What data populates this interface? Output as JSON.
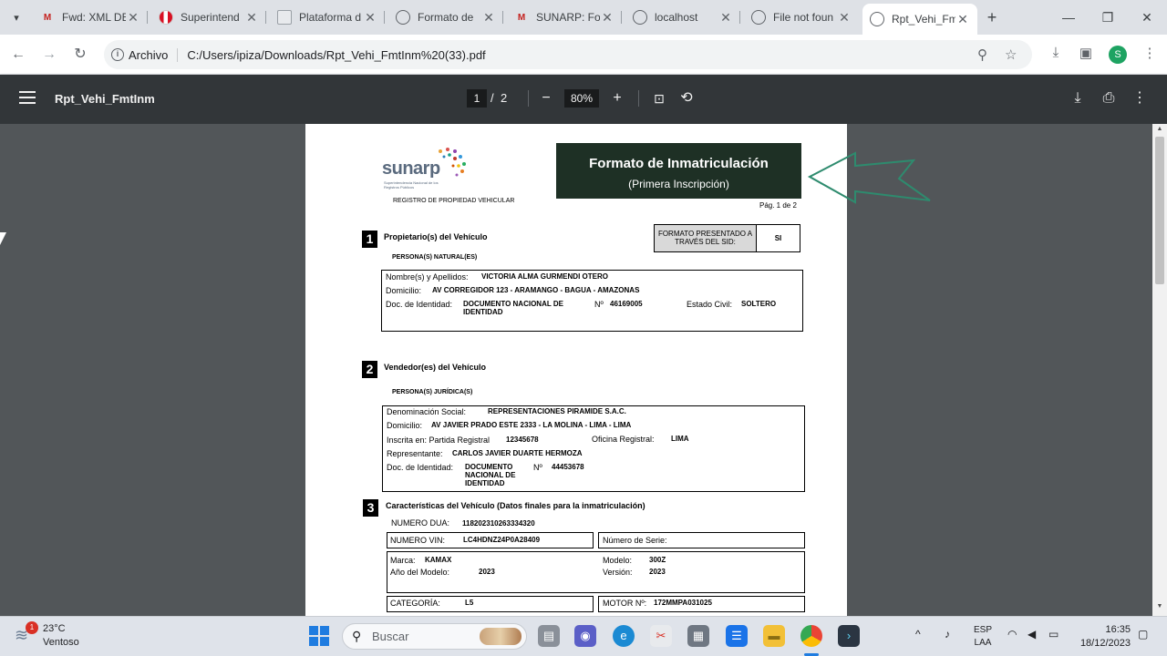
{
  "tabs": [
    {
      "title": "Fwd: XML DE",
      "favicon": "gmail-icon",
      "color": "#c5221f"
    },
    {
      "title": "Superintend",
      "favicon": "peru-flag-icon",
      "color": "#d91023"
    },
    {
      "title": "Plataforma d",
      "favicon": "document-icon",
      "color": "#8a8f95"
    },
    {
      "title": "Formato de",
      "favicon": "globe-icon",
      "color": "#5f6368"
    },
    {
      "title": "SUNARP: Fo",
      "favicon": "gmail-icon",
      "color": "#c5221f"
    },
    {
      "title": "localhost",
      "favicon": "globe-icon",
      "color": "#5f6368"
    },
    {
      "title": "File not foun",
      "favicon": "globe-icon",
      "color": "#5f6368"
    },
    {
      "title": "Rpt_Vehi_Fm",
      "favicon": "globe-icon",
      "color": "#5f6368",
      "active": true
    }
  ],
  "address": {
    "chip": "Archivo",
    "url": "C:/Users/ipiza/Downloads/Rpt_Vehi_FmtInm%20(33).pdf",
    "profile_initial": "S"
  },
  "pdf": {
    "title": "Rpt_Vehi_FmtInm",
    "current_page": "1",
    "separator": "/",
    "total_pages": "2",
    "zoom": "80%"
  },
  "document": {
    "logo": "sunarp",
    "logo_sub": "Superintendencia Nacional de los Registros Públicos",
    "registro": "REGISTRO DE PROPIEDAD VEHICULAR",
    "header_title": "Formato de Inmatriculación",
    "header_subtitle": "(Primera Inscripción)",
    "page_label": "Pág. 1 de 2",
    "sid_label": "FORMATO PRESENTADO A TRAVÉS DEL SID:",
    "sid_value": "SI",
    "section1": {
      "num": "1",
      "title": "Propietario(s) del Vehículo",
      "subtitle": "PERSONA(S) NATURAL(ES)",
      "name_label": "Nombre(s) y Apellidos:",
      "name_value": "VICTORIA ALMA GURMENDI OTERO",
      "dom_label": "Domicilio:",
      "dom_value": "AV CORREGIDOR 123 - ARAMANGO - BAGUA - AMAZONAS",
      "doc_label": "Doc. de Identidad:",
      "doc_value": "DOCUMENTO NACIONAL DE IDENTIDAD",
      "num_label": "Nº",
      "num_value": "46169005",
      "civil_label": "Estado Civil:",
      "civil_value": "SOLTERO"
    },
    "section2": {
      "num": "2",
      "title": "Vendedor(es) del Vehículo",
      "subtitle": "PERSONA(S) JURÍDICA(S)",
      "den_label": "Denominación Social:",
      "den_value": "REPRESENTACIONES PIRAMIDE S.A.C.",
      "dom_label": "Domicilio:",
      "dom_value": "AV JAVIER PRADO ESTE 2333 - LA MOLINA - LIMA - LIMA",
      "part_label": "Inscrita en: Partida Registral",
      "part_value": "12345678",
      "ofi_label": "Oficina Registral:",
      "ofi_value": "LIMA",
      "rep_label": "Representante:",
      "rep_value": "CARLOS JAVIER DUARTE HERMOZA",
      "doc_label": "Doc. de Identidad:",
      "doc_value": "DOCUMENTO NACIONAL DE IDENTIDAD",
      "num_label": "Nº",
      "num_value": "44453678"
    },
    "section3": {
      "num": "3",
      "title": "Características del Vehículo (Datos finales para la inmatriculación)",
      "dua_label": "NUMERO DUA:",
      "dua_value": "118202310263334320",
      "vin_label": "NUMERO VIN:",
      "vin_value": "LC4HDNZ24P0A28409",
      "serie_label": "Número de Serie:",
      "marca_label": "Marca:",
      "marca_value": "KAMAX",
      "anio_label": "Año del Modelo:",
      "anio_value": "2023",
      "modelo_label": "Modelo:",
      "modelo_value": "300Z",
      "version_label": "Versión:",
      "version_value": "2023",
      "cat_label": "CATEGORÍA:",
      "cat_value": "L5",
      "motor_label": "MOTOR Nº:",
      "motor_value": "172MMPA031025"
    }
  },
  "taskbar": {
    "temp": "23°C",
    "condition": "Ventoso",
    "badge": "1",
    "search_placeholder": "Buscar",
    "lang_1": "ESP",
    "lang_2": "LAA",
    "time": "16:35",
    "date": "18/12/2023"
  },
  "colors": {
    "header_bg": "#1e3025",
    "pdf_toolbar": "#323639",
    "viewer_bg": "#525659",
    "arrow": "#2e8b6e"
  }
}
